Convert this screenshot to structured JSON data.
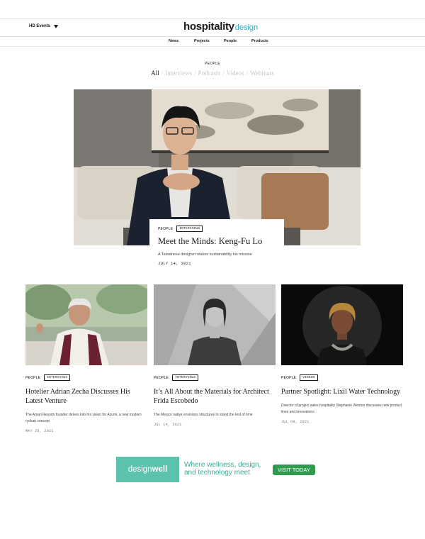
{
  "header": {
    "events_label": "HD Events",
    "logo_main": "hospitality",
    "logo_sub": "design"
  },
  "nav": {
    "items": [
      "News",
      "Projects",
      "People",
      "Products"
    ]
  },
  "section": {
    "label": "PEOPLE",
    "filters": [
      "All",
      "Interviews",
      "Podcasts",
      "Videos",
      "Webinars"
    ],
    "active_filter": "All"
  },
  "hero": {
    "category": "PEOPLE",
    "type": "INTERVIEWS",
    "title": "Meet the Minds: Keng-Fu Lo",
    "description": "A Taiwanese designer makes sustainability his mission",
    "date": "JULY 14, 2021"
  },
  "cards": [
    {
      "category": "PEOPLE",
      "type": "INTERVIEWS",
      "title": "Hotelier Adrian Zecha Discusses His Latest Venture",
      "description": "The Aman Resorts founder delves into his vision for Azumi, a new modern ryokan concept",
      "date": "MAY 25, 2021"
    },
    {
      "category": "PEOPLE",
      "type": "INTERVIEWS",
      "title": "It’s All About the Materials for Architect Frida Escobedo",
      "description": "The Mexico native envisions structures to stand the test of time",
      "date": "JUL 14, 2021"
    },
    {
      "category": "PEOPLE",
      "type": "VIDEOS",
      "title": "Partner Spotlight: Lixil Water Technology",
      "description": "Director of project sales hospitality Stephanie Weston discusses new product lines and innovations",
      "date": "JUL 09, 2021"
    }
  ],
  "ad": {
    "brand_a": "design",
    "brand_b": "well",
    "line1": "Where wellness, design,",
    "line2": "and technology meet",
    "cta": "VISIT TODAY"
  },
  "colors": {
    "logo_accent": "#2ba6c5",
    "ad_teal": "#5cc2ad",
    "ad_button": "#2f9b4e",
    "filter_inactive": "#c6c6c6"
  }
}
